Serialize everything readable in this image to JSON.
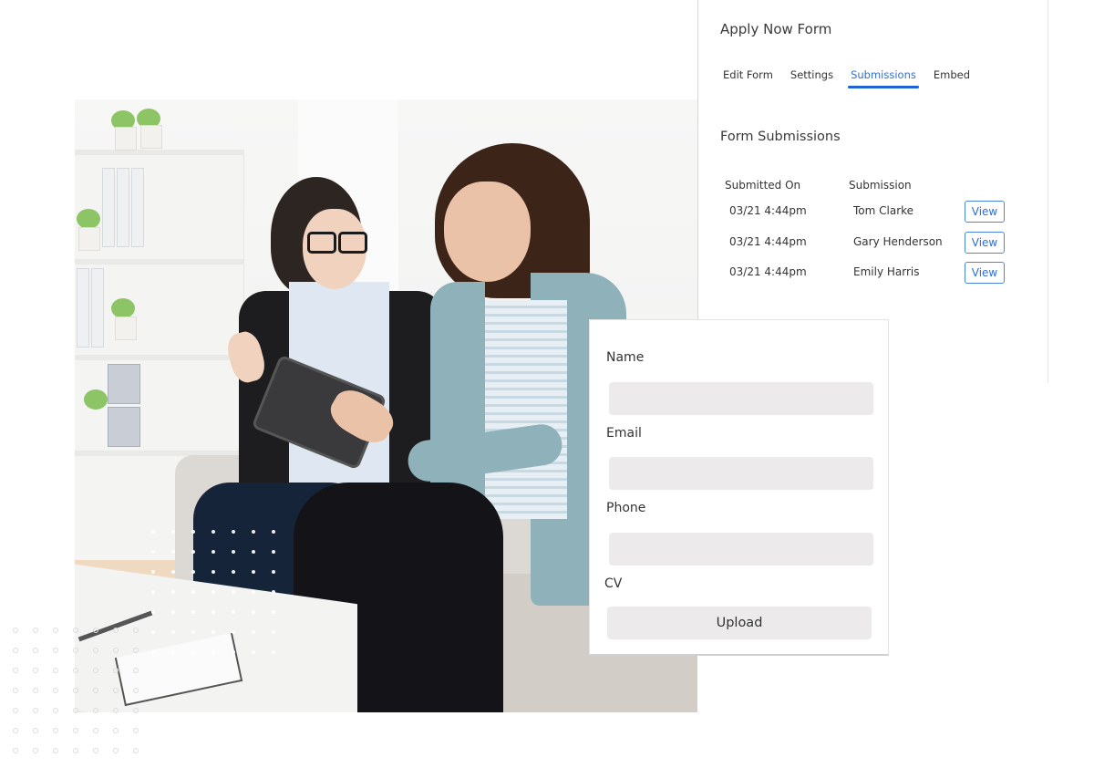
{
  "panel": {
    "title": "Apply Now Form",
    "tabs": [
      {
        "label": "Edit Form",
        "active": false
      },
      {
        "label": "Settings",
        "active": false
      },
      {
        "label": "Submissions",
        "active": true
      },
      {
        "label": "Embed",
        "active": false
      }
    ],
    "section_title": "Form Submissions",
    "table": {
      "headers": [
        "Submitted On",
        "Submission"
      ],
      "rows": [
        {
          "date": "03/21 4:44pm",
          "name": "Tom Clarke",
          "action": "View"
        },
        {
          "date": "03/21 4:44pm",
          "name": "Gary Henderson",
          "action": "View"
        },
        {
          "date": "03/21 4:44pm",
          "name": "Emily Harris",
          "action": "View"
        }
      ]
    }
  },
  "form": {
    "fields": [
      {
        "label": "Name",
        "value": "",
        "placeholder": ""
      },
      {
        "label": "Email",
        "value": "",
        "placeholder": ""
      },
      {
        "label": "Phone",
        "value": "",
        "placeholder": ""
      }
    ],
    "cv_label": "CV",
    "upload_label": "Upload"
  },
  "photo": {
    "description": "Two women seated on a sofa reviewing a tablet"
  },
  "colors": {
    "accent": "#1f63d2",
    "link": "#2f6fd6",
    "input_bg": "#eceaeb"
  }
}
